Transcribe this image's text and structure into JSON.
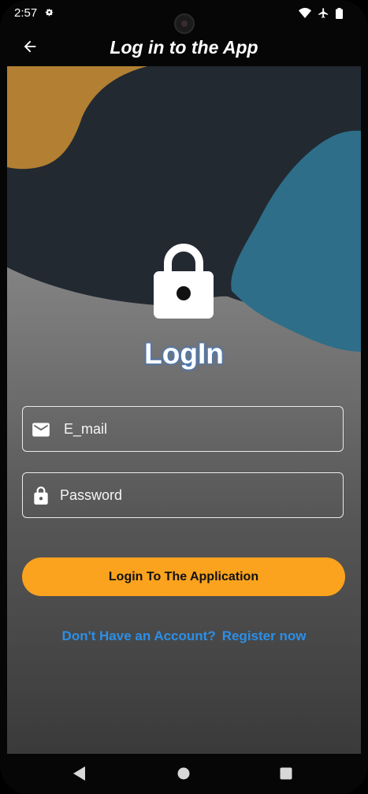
{
  "status_bar": {
    "time": "2:57",
    "icons": [
      "gear-icon",
      "wifi-icon",
      "airplane-icon",
      "battery-icon"
    ]
  },
  "app_bar": {
    "back_icon": "arrow-left-icon",
    "title": "Log in to the App"
  },
  "login": {
    "heading": "LogIn",
    "lock_icon": "padlock-icon",
    "email_placeholder": "E_mail",
    "email_icon": "mail-icon",
    "password_placeholder": "Password",
    "password_icon": "lock-icon",
    "submit_label": "Login To The Application",
    "no_account_text": "Don't Have an Account?",
    "register_text": "Register now"
  },
  "colors": {
    "accent": "#fba31e",
    "link": "#2b8fe8",
    "wave_orange": "#b27f33",
    "wave_dark": "#222931",
    "wave_teal": "#2e6e89"
  },
  "nav_bar": {
    "icons": [
      "nav-back-icon",
      "nav-home-icon",
      "nav-recents-icon"
    ]
  }
}
